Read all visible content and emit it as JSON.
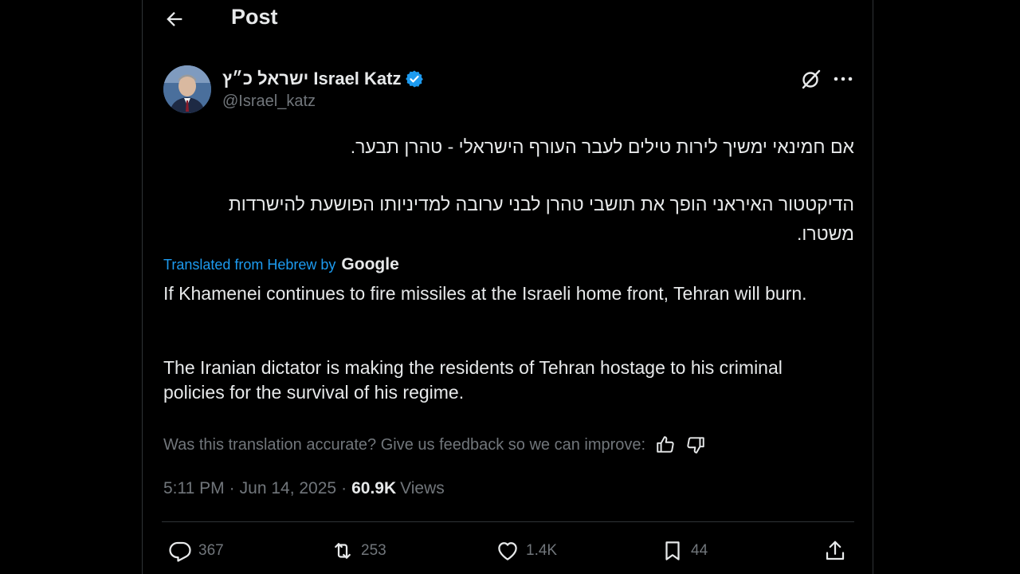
{
  "header": {
    "title": "Post"
  },
  "author": {
    "display_name": "ישראל כ״ץ Israel Katz",
    "handle": "@Israel_katz",
    "verified": true
  },
  "post": {
    "hebrew_paragraphs": [
      "אם חמינאי ימשיך לירות טילים לעבר העורף הישראלי - טהרן תבער.",
      "הדיקטטור האיראני הופך את תושבי טהרן לבני ערובה למדיניותו הפושעת להישרדות משטרו."
    ],
    "translation_label": "Translated from Hebrew by",
    "translation_provider": "Google",
    "english_paragraphs": [
      "If Khamenei continues to fire missiles at the Israeli home front, Tehran will burn.",
      "The Iranian dictator is making the residents of Tehran hostage to his criminal policies for the survival of his regime."
    ],
    "feedback_prompt": "Was this translation accurate? Give us feedback so we can improve:"
  },
  "meta": {
    "time": "5:11 PM",
    "date": "Jun 14, 2025",
    "separator": "·",
    "views_count": "60.9K",
    "views_label": "Views"
  },
  "actions": {
    "replies": "367",
    "reposts": "253",
    "likes": "1.4K",
    "bookmarks": "44"
  },
  "icons": {
    "back": "arrow-left-icon",
    "verified": "verified-badge-icon",
    "grok": "grok-icon",
    "more": "more-horizontal-icon",
    "thumbs_up": "thumbs-up-icon",
    "thumbs_down": "thumbs-down-icon",
    "reply": "reply-icon",
    "repost": "repost-icon",
    "like": "heart-icon",
    "bookmark": "bookmark-icon",
    "share": "share-icon"
  },
  "colors": {
    "background": "#000000",
    "text": "#e7e9ea",
    "muted": "#71767b",
    "accent": "#1d9bf0",
    "border": "#2f3336"
  }
}
